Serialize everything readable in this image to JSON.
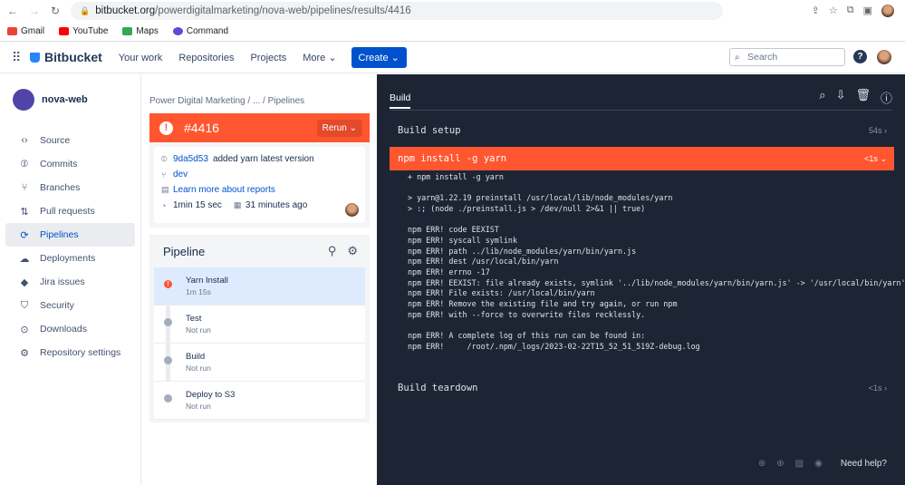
{
  "browser": {
    "url_host": "bitbucket.org",
    "url_path": "/powerdigitalmarketing/nova-web/pipelines/results/4416",
    "bookmarks": [
      "Gmail",
      "YouTube",
      "Maps",
      "Command"
    ]
  },
  "topnav": {
    "brand": "Bitbucket",
    "links": [
      "Your work",
      "Repositories",
      "Projects",
      "More ⌄"
    ],
    "create": "Create ⌄",
    "search_placeholder": "Search",
    "help": "?"
  },
  "sidebar": {
    "repo": "nova-web",
    "items": [
      {
        "label": "Source",
        "icon": "‹›"
      },
      {
        "label": "Commits",
        "icon": "⦶"
      },
      {
        "label": "Branches",
        "icon": "⑂"
      },
      {
        "label": "Pull requests",
        "icon": "⇅"
      },
      {
        "label": "Pipelines",
        "icon": "⟳"
      },
      {
        "label": "Deployments",
        "icon": "☁"
      },
      {
        "label": "Jira issues",
        "icon": "◆"
      },
      {
        "label": "Security",
        "icon": "⛉"
      },
      {
        "label": "Downloads",
        "icon": "⊙"
      },
      {
        "label": "Repository settings",
        "icon": "⚙"
      }
    ]
  },
  "pipeline_run": {
    "breadcrumb": "Power Digital Marketing  /  ...  /  Pipelines",
    "number": "#4416",
    "rerun": "Rerun ⌄",
    "commit_hash": "9da5d53",
    "commit_msg": "added yarn latest version",
    "branch": "dev",
    "reports_link": "Learn more about reports",
    "duration": "1min 15 sec",
    "time_ago": "31 minutes ago"
  },
  "pipeline": {
    "title": "Pipeline",
    "steps": [
      {
        "name": "Yarn Install",
        "status": "1m 15s"
      },
      {
        "name": "Test",
        "status": "Not run"
      },
      {
        "name": "Build",
        "status": "Not run"
      },
      {
        "name": "Deploy to S3",
        "status": "Not run"
      }
    ]
  },
  "build": {
    "tab": "Build",
    "sections": [
      {
        "name": "Build setup",
        "time": "54s"
      },
      {
        "name": "npm install -g yarn",
        "time": "<1s"
      },
      {
        "name": "Build teardown",
        "time": "<1s"
      }
    ],
    "log": "+ npm install -g yarn\n\n> yarn@1.22.19 preinstall /usr/local/lib/node_modules/yarn\n> :; (node ./preinstall.js > /dev/null 2>&1 || true)\n\nnpm ERR! code EEXIST\nnpm ERR! syscall symlink\nnpm ERR! path ../lib/node_modules/yarn/bin/yarn.js\nnpm ERR! dest /usr/local/bin/yarn\nnpm ERR! errno -17\nnpm ERR! EEXIST: file already exists, symlink '../lib/node_modules/yarn/bin/yarn.js' -> '/usr/local/bin/yarn'\nnpm ERR! File exists: /usr/local/bin/yarn\nnpm ERR! Remove the existing file and try again, or run npm\nnpm ERR! with --force to overwrite files recklessly.\n\nnpm ERR! A complete log of this run can be found in:\nnpm ERR!     /root/.npm/_logs/2023-02-22T15_52_51_519Z-debug.log",
    "help": "Need help?"
  },
  "colors": {
    "accent": "#0052cc",
    "failed": "#ff5630",
    "log_bg": "#1d2535"
  }
}
